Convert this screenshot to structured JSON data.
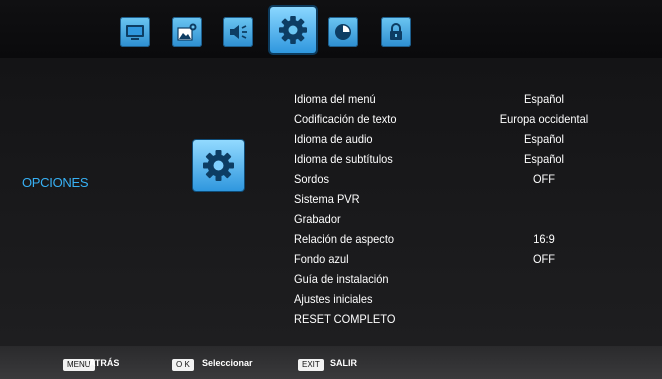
{
  "top_tabs": [
    {
      "icon": "monitor-icon"
    },
    {
      "icon": "picture-settings-icon"
    },
    {
      "icon": "speaker-icon"
    },
    {
      "icon": "gear-icon",
      "active": true
    },
    {
      "icon": "clock-icon"
    },
    {
      "icon": "lock-icon"
    }
  ],
  "section": {
    "title": "OPCIONES",
    "icon": "gear-icon"
  },
  "menu": [
    {
      "label": "Idioma del menú",
      "value": "Español"
    },
    {
      "label": "Codificación de texto",
      "value": "Europa occidental"
    },
    {
      "label": "Idioma de audio",
      "value": "Español"
    },
    {
      "label": "Idioma de subtítulos",
      "value": "Español"
    },
    {
      "label": "Sordos",
      "value": "OFF"
    },
    {
      "label": "Sistema PVR",
      "value": ""
    },
    {
      "label": "Grabador",
      "value": ""
    },
    {
      "label": "Relación de aspecto",
      "value": "16:9"
    },
    {
      "label": "Fondo azul",
      "value": "OFF"
    },
    {
      "label": "Guía de instalación",
      "value": ""
    },
    {
      "label": "Ajustes iniciales",
      "value": ""
    },
    {
      "label": "RESET COMPLETO",
      "value": ""
    }
  ],
  "footer": {
    "menu_key": "MENU",
    "menu_hint": "ATRÁS",
    "ok_key": "O K",
    "ok_hint": "Seleccionar",
    "exit_key": "EXIT",
    "exit_hint": "SALIR"
  },
  "colors": {
    "accent": "#37b0f4",
    "tab_blue": "#2f97de"
  }
}
